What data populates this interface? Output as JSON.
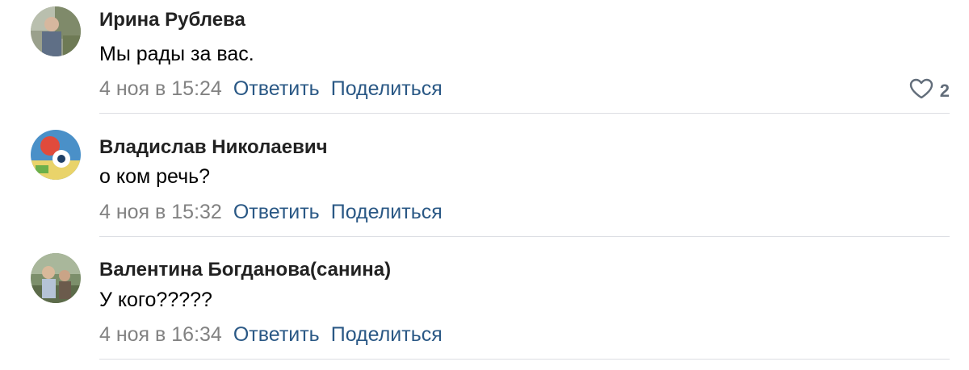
{
  "comments": [
    {
      "author": "Ирина Рублева",
      "text": "Мы рады за вас.",
      "date": "4 ноя в 15:24",
      "reply_label": "Ответить",
      "share_label": "Поделиться",
      "likes": "2"
    },
    {
      "author": "Владислав Николаевич",
      "text": "о ком речь?",
      "date": "4 ноя в 15:32",
      "reply_label": "Ответить",
      "share_label": "Поделиться"
    },
    {
      "author": "Валентина Богданова(санина)",
      "text": "У кого?????",
      "date": "4 ноя в 16:34",
      "reply_label": "Ответить",
      "share_label": "Поделиться"
    }
  ],
  "colors": {
    "link": "#2a5885",
    "meta": "#828282",
    "divider": "#dcdee3",
    "like_icon": "#626d7a"
  },
  "icons": {
    "like": "heart-icon"
  }
}
